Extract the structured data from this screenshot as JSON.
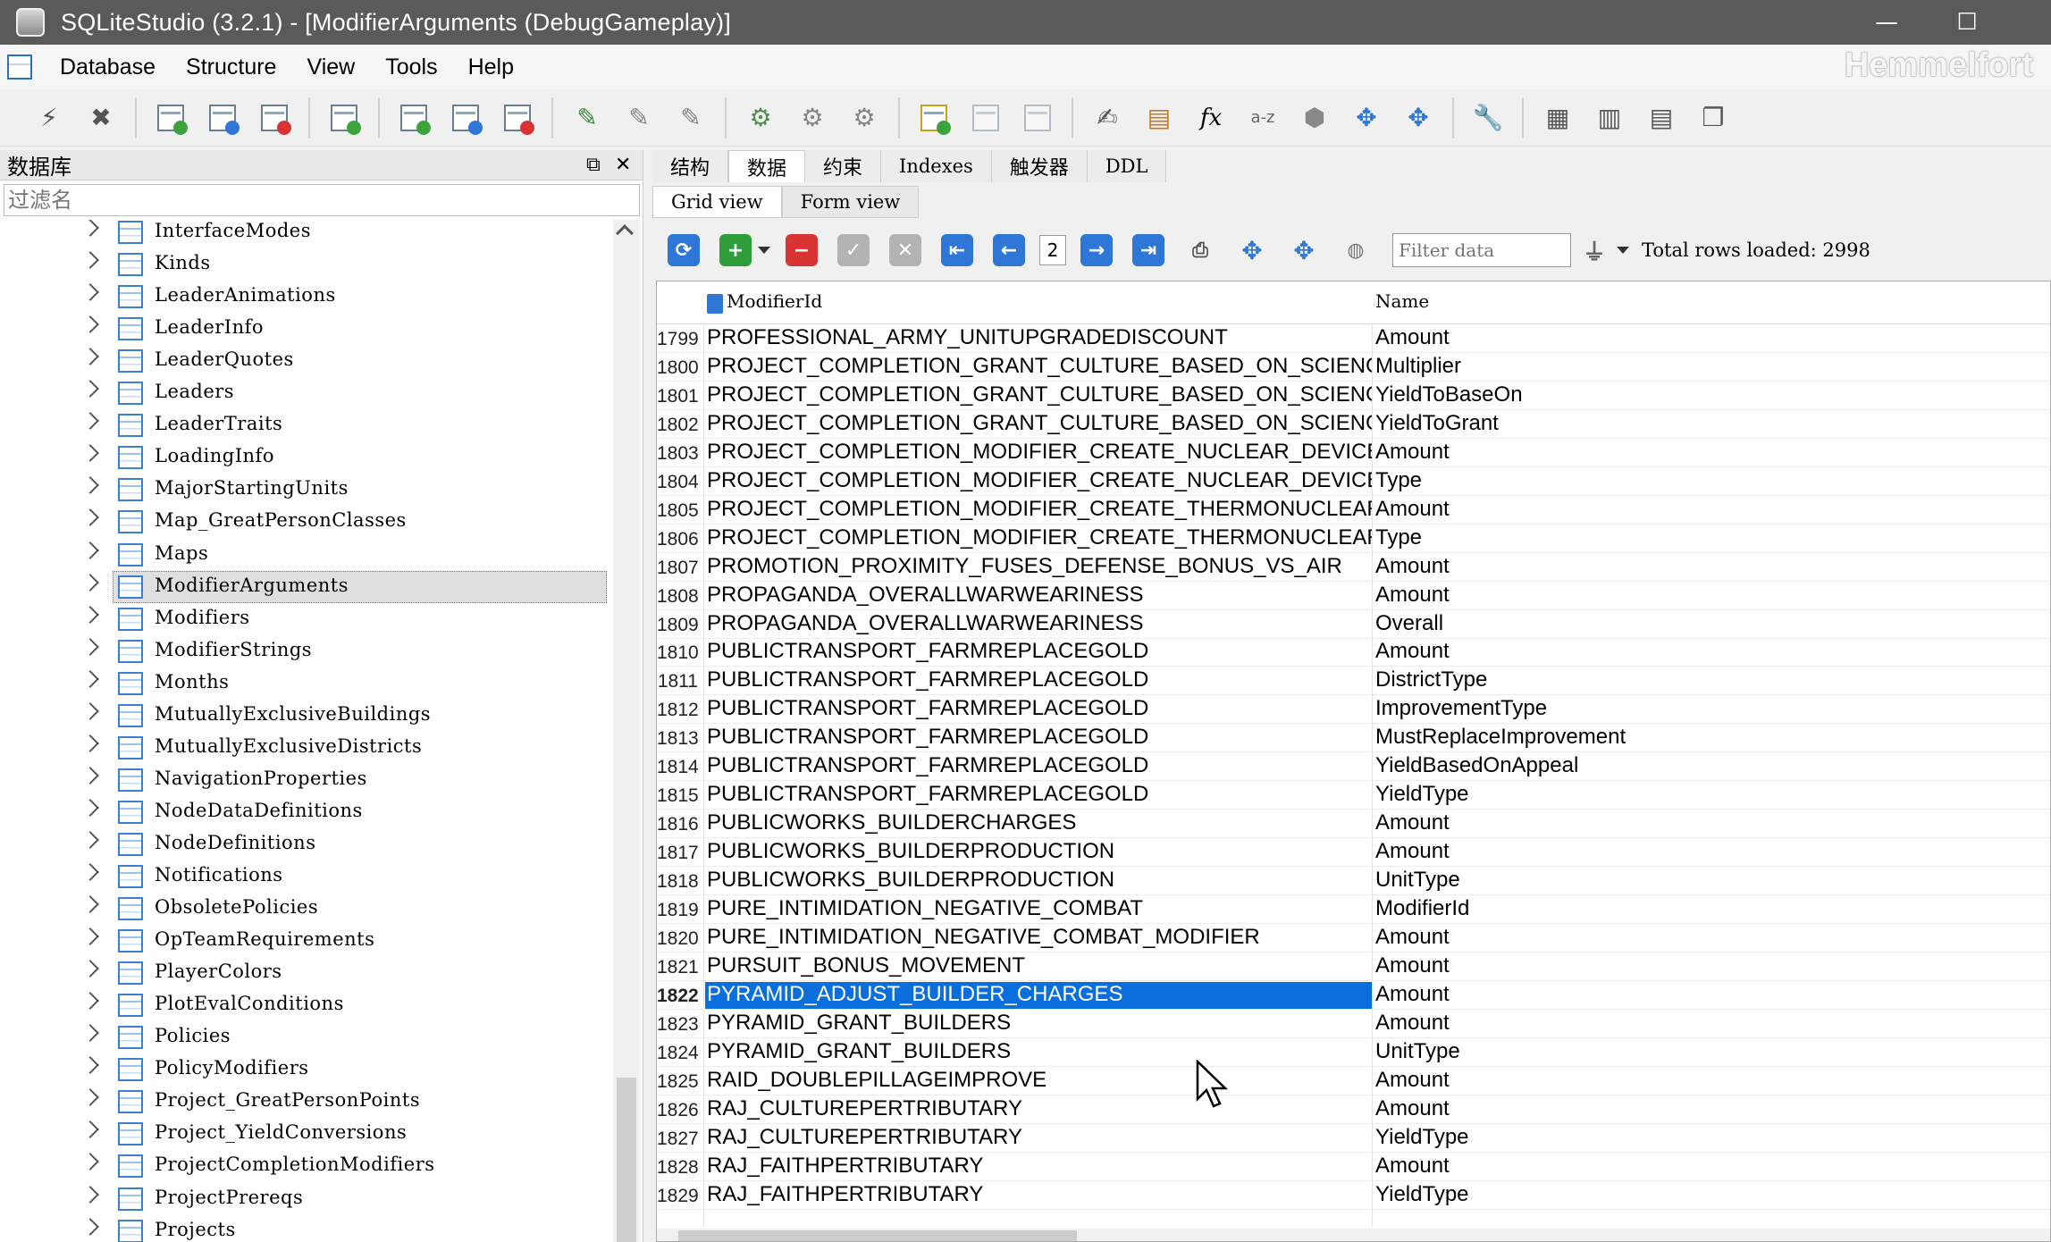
{
  "window": {
    "title": "SQLiteStudio (3.2.1) - [ModifierArguments (DebugGameplay)]",
    "minimize": "—",
    "maximize": "☐"
  },
  "watermark": "Hemmelfort",
  "menu": [
    "Database",
    "Structure",
    "View",
    "Tools",
    "Help"
  ],
  "left_panel": {
    "title": "数据库",
    "filter_placeholder": "过滤名",
    "tables": [
      "InterfaceModes",
      "Kinds",
      "LeaderAnimations",
      "LeaderInfo",
      "LeaderQuotes",
      "Leaders",
      "LeaderTraits",
      "LoadingInfo",
      "MajorStartingUnits",
      "Map_GreatPersonClasses",
      "Maps",
      "ModifierArguments",
      "Modifiers",
      "ModifierStrings",
      "Months",
      "MutuallyExclusiveBuildings",
      "MutuallyExclusiveDistricts",
      "NavigationProperties",
      "NodeDataDefinitions",
      "NodeDefinitions",
      "Notifications",
      "ObsoletePolicies",
      "OpTeamRequirements",
      "PlayerColors",
      "PlotEvalConditions",
      "Policies",
      "PolicyModifiers",
      "Project_GreatPersonPoints",
      "Project_YieldConversions",
      "ProjectCompletionModifiers",
      "ProjectPrereqs",
      "Projects"
    ],
    "selected_table": "ModifierArguments"
  },
  "tabs": [
    "结构",
    "数据",
    "约束",
    "Indexes",
    "触发器",
    "DDL"
  ],
  "active_tab": "数据",
  "subtabs": [
    "Grid view",
    "Form view"
  ],
  "active_subtab": "Grid view",
  "grid_toolbar": {
    "page": "2",
    "filter_placeholder": "Filter data",
    "total_rows": "Total rows loaded: 2998"
  },
  "grid": {
    "columns": [
      "ModifierId",
      "Name"
    ],
    "selected_row": "1822",
    "rows": [
      [
        "1799",
        "PROFESSIONAL_ARMY_UNITUPGRADEDISCOUNT",
        "Amount"
      ],
      [
        "1800",
        "PROJECT_COMPLETION_GRANT_CULTURE_BASED_ON_SCIENCE_RATE",
        "Multiplier"
      ],
      [
        "1801",
        "PROJECT_COMPLETION_GRANT_CULTURE_BASED_ON_SCIENCE_RATE",
        "YieldToBaseOn"
      ],
      [
        "1802",
        "PROJECT_COMPLETION_GRANT_CULTURE_BASED_ON_SCIENCE_RATE",
        "YieldToGrant"
      ],
      [
        "1803",
        "PROJECT_COMPLETION_MODIFIER_CREATE_NUCLEAR_DEVICE",
        "Amount"
      ],
      [
        "1804",
        "PROJECT_COMPLETION_MODIFIER_CREATE_NUCLEAR_DEVICE",
        "Type"
      ],
      [
        "1805",
        "PROJECT_COMPLETION_MODIFIER_CREATE_THERMONUCLEAR_DEVICE",
        "Amount"
      ],
      [
        "1806",
        "PROJECT_COMPLETION_MODIFIER_CREATE_THERMONUCLEAR_DEVICE",
        "Type"
      ],
      [
        "1807",
        "PROMOTION_PROXIMITY_FUSES_DEFENSE_BONUS_VS_AIR",
        "Amount"
      ],
      [
        "1808",
        "PROPAGANDA_OVERALLWARWEARINESS",
        "Amount"
      ],
      [
        "1809",
        "PROPAGANDA_OVERALLWARWEARINESS",
        "Overall"
      ],
      [
        "1810",
        "PUBLICTRANSPORT_FARMREPLACEGOLD",
        "Amount"
      ],
      [
        "1811",
        "PUBLICTRANSPORT_FARMREPLACEGOLD",
        "DistrictType"
      ],
      [
        "1812",
        "PUBLICTRANSPORT_FARMREPLACEGOLD",
        "ImprovementType"
      ],
      [
        "1813",
        "PUBLICTRANSPORT_FARMREPLACEGOLD",
        "MustReplaceImprovement"
      ],
      [
        "1814",
        "PUBLICTRANSPORT_FARMREPLACEGOLD",
        "YieldBasedOnAppeal"
      ],
      [
        "1815",
        "PUBLICTRANSPORT_FARMREPLACEGOLD",
        "YieldType"
      ],
      [
        "1816",
        "PUBLICWORKS_BUILDERCHARGES",
        "Amount"
      ],
      [
        "1817",
        "PUBLICWORKS_BUILDERPRODUCTION",
        "Amount"
      ],
      [
        "1818",
        "PUBLICWORKS_BUILDERPRODUCTION",
        "UnitType"
      ],
      [
        "1819",
        "PURE_INTIMIDATION_NEGATIVE_COMBAT",
        "ModifierId"
      ],
      [
        "1820",
        "PURE_INTIMIDATION_NEGATIVE_COMBAT_MODIFIER",
        "Amount"
      ],
      [
        "1821",
        "PURSUIT_BONUS_MOVEMENT",
        "Amount"
      ],
      [
        "1822",
        "PYRAMID_ADJUST_BUILDER_CHARGES",
        "Amount"
      ],
      [
        "1823",
        "PYRAMID_GRANT_BUILDERS",
        "Amount"
      ],
      [
        "1824",
        "PYRAMID_GRANT_BUILDERS",
        "UnitType"
      ],
      [
        "1825",
        "RAID_DOUBLEPILLAGEIMPROVE",
        "Amount"
      ],
      [
        "1826",
        "RAJ_CULTUREPERTRIBUTARY",
        "Amount"
      ],
      [
        "1827",
        "RAJ_CULTUREPERTRIBUTARY",
        "YieldType"
      ],
      [
        "1828",
        "RAJ_FAITHPERTRIBUTARY",
        "Amount"
      ],
      [
        "1829",
        "RAJ_FAITHPERTRIBUTARY",
        "YieldType"
      ]
    ]
  }
}
